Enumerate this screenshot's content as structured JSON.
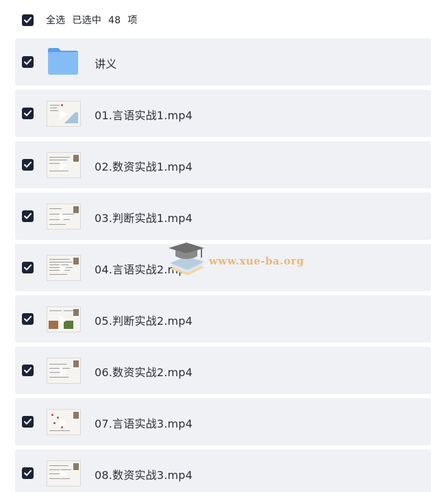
{
  "header": {
    "select_all_label": "全选",
    "selected_prefix": "已选中",
    "selected_count": "48",
    "selected_suffix": "项"
  },
  "items": [
    {
      "name": "讲义",
      "type": "folder",
      "checked": true,
      "icon": "folder-icon"
    },
    {
      "name": "01.言语实战1.mp4",
      "type": "video",
      "checked": true,
      "icon": "video-thumbnail"
    },
    {
      "name": "02.数资实战1.mp4",
      "type": "video",
      "checked": true,
      "icon": "video-thumbnail"
    },
    {
      "name": "03.判断实战1.mp4",
      "type": "video",
      "checked": true,
      "icon": "video-thumbnail"
    },
    {
      "name": "04.言语实战2.mp4",
      "type": "video",
      "checked": true,
      "icon": "video-thumbnail"
    },
    {
      "name": "05.判断实战2.mp4",
      "type": "video",
      "checked": true,
      "icon": "video-thumbnail"
    },
    {
      "name": "06.数资实战2.mp4",
      "type": "video",
      "checked": true,
      "icon": "video-thumbnail"
    },
    {
      "name": "07.言语实战3.mp4",
      "type": "video",
      "checked": true,
      "icon": "video-thumbnail"
    },
    {
      "name": "08.数资实战3.mp4",
      "type": "video",
      "checked": true,
      "icon": "video-thumbnail"
    }
  ],
  "watermark": {
    "text": "www.xue-ba.org",
    "icon": "graduation-cap-books-logo"
  },
  "colors": {
    "checkbox": "#1d2336",
    "row_background": "#f0f1f4",
    "folder": "#7fb6f2",
    "watermark_text": "#e6b879"
  }
}
